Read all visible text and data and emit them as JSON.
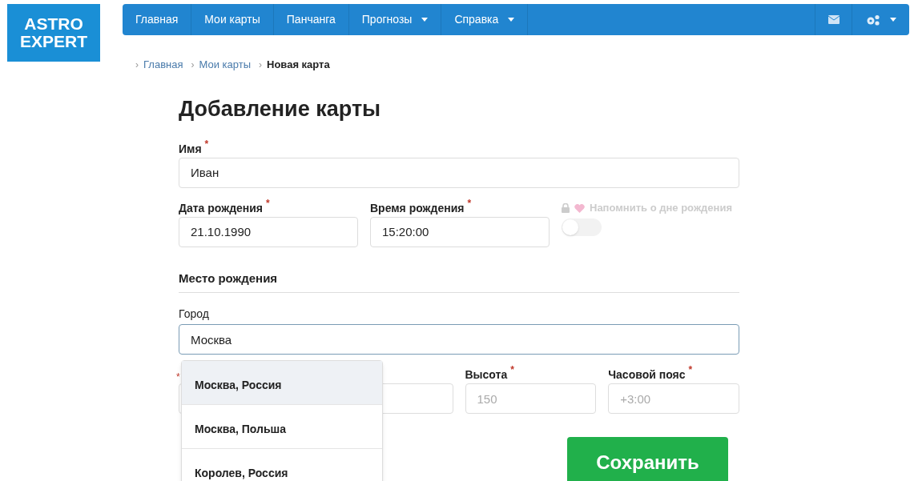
{
  "logo": {
    "line1": "ASTRO",
    "line2": "EXPERT"
  },
  "nav": {
    "items": [
      {
        "label": "Главная",
        "dropdown": false
      },
      {
        "label": "Мои карты",
        "dropdown": false
      },
      {
        "label": "Панчанга",
        "dropdown": false
      },
      {
        "label": "Прогнозы",
        "dropdown": true
      },
      {
        "label": "Справка",
        "dropdown": true
      }
    ]
  },
  "breadcrumb": [
    {
      "separator": "›",
      "label": "Главная",
      "current": false
    },
    {
      "separator": "›",
      "label": "Мои карты",
      "current": false
    },
    {
      "separator": "›",
      "label": "Новая карта",
      "current": true
    }
  ],
  "page_title": "Добавление карты",
  "name_field": {
    "label": "Имя",
    "required_mark": "*",
    "value": "Иван"
  },
  "date_field": {
    "label": "Дата рождения",
    "required_mark": "*",
    "value": "21.10.1990"
  },
  "time_field": {
    "label": "Время рождения",
    "required_mark": "*",
    "value": "15:20:00"
  },
  "reminder": {
    "label": "Напомнить о дне рождения",
    "disabled": true,
    "on": false
  },
  "section_title": "Место рождения",
  "city_field": {
    "label": "Город",
    "value": "Москва"
  },
  "location_fields": [
    {
      "kind": "covered",
      "required_mark": "*"
    },
    {
      "kind": "covered"
    },
    {
      "kind": "labeled",
      "label": "Высота",
      "required_mark": "*",
      "placeholder": "150"
    },
    {
      "kind": "labeled",
      "label": "Часовой пояс",
      "required_mark": "*",
      "placeholder": "+3:00"
    }
  ],
  "suggestions": [
    {
      "label": "Москва, Россия",
      "selected": true
    },
    {
      "label": "Москва, Польша",
      "selected": false
    },
    {
      "label": "Королев, Россия",
      "selected": false
    }
  ],
  "save_button": "Сохранить"
}
